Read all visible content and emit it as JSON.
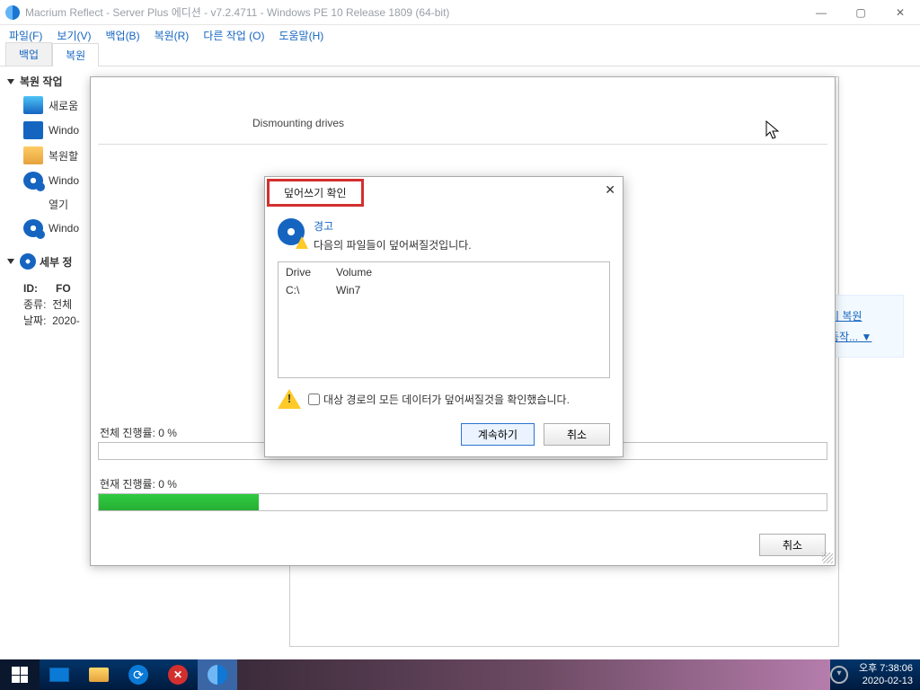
{
  "titlebar": {
    "title": "Macrium Reflect - Server Plus 에디션 - v7.2.4711 - Windows PE 10 Release 1809 (64-bit)"
  },
  "menu": {
    "file": "파일(F)",
    "view": "보기(V)",
    "backup": "백업(B)",
    "restore": "복원(R)",
    "other": "다른 작업 (O)",
    "help": "도움말(H)"
  },
  "tabs": {
    "backup": "백업",
    "restore": "복원"
  },
  "nav": {
    "section_restore_tasks": "복원 작업",
    "items": [
      {
        "label": "새로움"
      },
      {
        "label": "Windo"
      },
      {
        "label": "복원할"
      },
      {
        "label": "Windo"
      },
      {
        "label": "열기"
      },
      {
        "label": "Windo"
      }
    ],
    "section_details": "세부 정",
    "details": {
      "id_key": "ID:",
      "id_val": "FO",
      "kind_key": "종류:",
      "kind_val": "전체",
      "date_key": "날짜:",
      "date_val": "2020-"
    }
  },
  "rightlinks": {
    "l1": "지 복원",
    "l2": "동작...",
    "arrow": "▼"
  },
  "progress": {
    "header": "Dismounting drives",
    "overall_label": "전체 진행률:  0 %",
    "current_label": "현재 진행률:  0 %",
    "current_fill_pct": 22,
    "cancel": "취소"
  },
  "confirm": {
    "title": "덮어쓰기 확인",
    "warn_title": "경고",
    "warn_text": "다음의 파일들이 덮어써질것입니다.",
    "col_drive": "Drive",
    "col_volume": "Volume",
    "row_drive": "C:\\",
    "row_volume": "Win7",
    "ack": "대상 경로의 모든 데이터가 덮어써질것을 확인했습니다.",
    "continue": "계속하기",
    "cancel": "취소"
  },
  "taskbar": {
    "ampm": "오후",
    "time": "7:38:06",
    "date": "2020-02-13"
  }
}
